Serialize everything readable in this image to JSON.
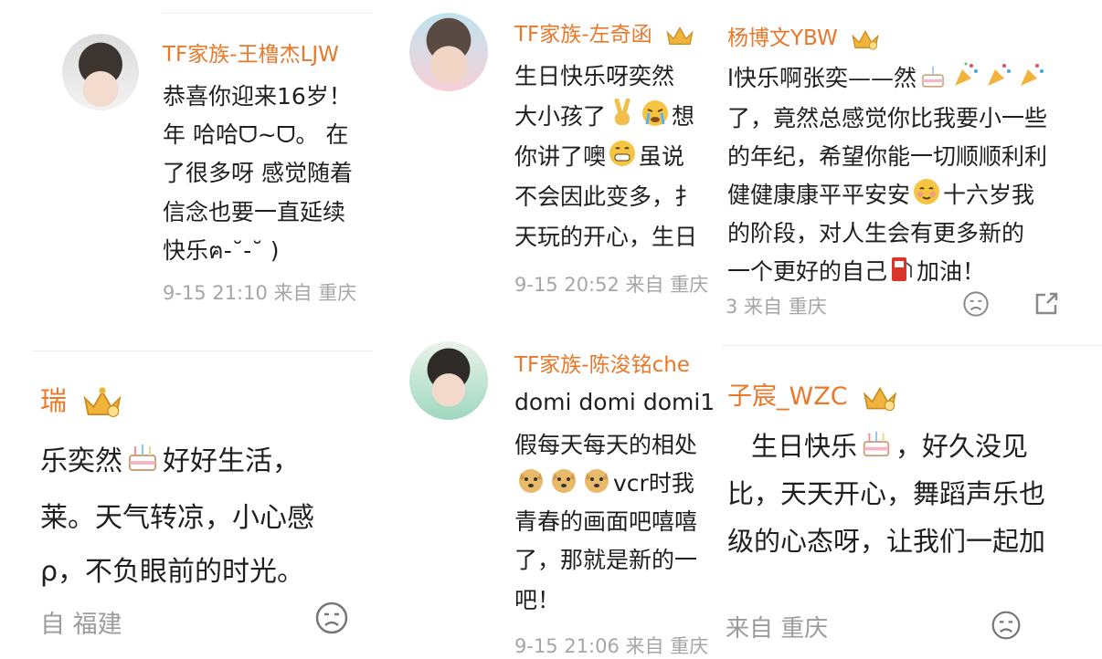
{
  "colors": {
    "username": "#e8782a",
    "body_text": "#1f1f1f",
    "meta_text": "#a6a6a6",
    "divider": "#eeeeee"
  },
  "c1": {
    "username": "TF家族-王橹杰LJW",
    "lines": [
      "恭喜你迎来16岁！",
      "年 哈哈ᗜ~ᗜ。 在",
      "了很多呀 感觉随着",
      "信念也要一直延续",
      "快乐ฅ-˘-˘ )"
    ],
    "meta": "9-15 21:10 来自 重庆"
  },
  "c2": {
    "username": "瑞",
    "l1a": "乐奕然",
    "l1b": "好好生活，",
    "l2": "莱。天气转凉，小心感",
    "l3": "ρ，不负眼前的时光。",
    "meta": "自 福建"
  },
  "c3": {
    "username": "TF家族-左奇函",
    "l1": "生日快乐呀奕然",
    "l2": "大小孩了",
    "l3a": "你讲了噢",
    "l3b": "虽说",
    "l4": "不会因此变多，扌",
    "l5": "天玩的开心，生日",
    "meta": "9-15 20:52 来自 重庆"
  },
  "c4": {
    "username": "TF家族-陈浚铭che",
    "l1": "domi domi domi1",
    "l2": "假每天每天的相处",
    "l3": "vcr时我",
    "l4": "青春的画面吧嘻嘻",
    "l5": "了，那就是新的一",
    "l6": "吧！",
    "meta": "9-15 21:06 来自 重庆"
  },
  "c5": {
    "username": "杨博文YBW",
    "l1": "l快乐啊张奕——然",
    "l2": "了，竟然总感觉你比我要小一些",
    "l3": "的年纪，希望你能一切顺顺利利",
    "l4a": "健健康康平平安安",
    "l4b": "十六岁我",
    "l5": "的阶段，对人生会有更多新的",
    "l6a": "一个更好的自己",
    "l6b": "加油！",
    "meta": "3 来自 重庆"
  },
  "c6": {
    "username": "子宸_WZC",
    "l1a": "生日快乐",
    "l1b": "，好久没见",
    "l2": "比，天天开心，舞蹈声乐也",
    "l3": "级的心态呀，让我们一起加",
    "meta": "来自 重庆"
  },
  "icons": [
    "crown-icon",
    "cake-icon",
    "victory-hand-icon",
    "crying-face-icon",
    "grin-face-icon",
    "doge-icon",
    "party-popper-icon",
    "blush-face-icon",
    "fuel-pump-icon",
    "dislike-face-icon",
    "share-icon"
  ]
}
